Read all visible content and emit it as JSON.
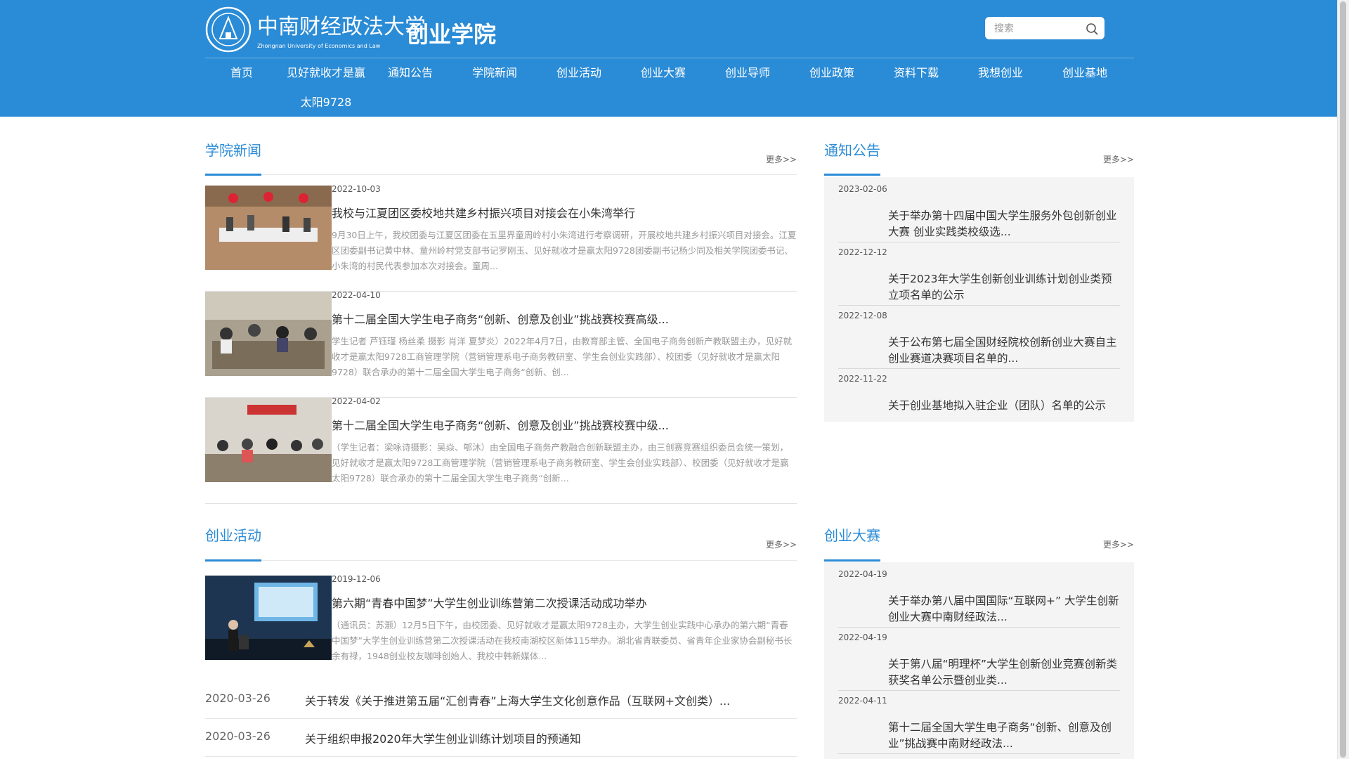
{
  "header": {
    "logo_cn": "中南财经政法大学",
    "logo_en": "Zhongnan University of Economics and Law",
    "site_name": "创业学院",
    "search_placeholder": "搜索"
  },
  "nav": [
    "首页",
    "见好就收才是赢",
    "通知公告",
    "学院新闻",
    "创业活动",
    "创业大赛",
    "创业导师",
    "创业政策",
    "资料下载",
    "我想创业",
    "创业基地",
    "太阳9728"
  ],
  "sections": {
    "news": {
      "title": "学院新闻",
      "more": "更多>>",
      "items": [
        {
          "date": "2022-10-03",
          "title": "我校与江夏团区委校地共建乡村振兴项目对接会在小朱湾举行",
          "summary": "9月30日上午，我校团委与江夏区团委在五里界童周岭村小朱湾进行考察调研，开展校地共建乡村振兴项目对接会。江夏区团委副书记黄中林、童州岭村党支部书记罗刚玉、见好就收才是赢太阳9728团委副书记杨少同及相关学院团委书记、小朱湾的村民代表参加本次对接会。童周..."
        },
        {
          "date": "2022-04-10",
          "title": "第十二届全国大学生电子商务“创新、创意及创业”挑战赛校赛高级...",
          "summary": "学生记者 芦钰瑾 杨丝柔 摄影 肖洋 夏梦炎）2022年4月7日，由教育部主管、全国电子商务创新产教联盟主办，见好就收才是赢太阳9728工商管理学院（营销管理系电子商务教研室、学生会创业实践部）、校团委（见好就收才是赢太阳9728）联合承办的第十二届全国大学生电子商务“创新、创..."
        },
        {
          "date": "2022-04-02",
          "title": "第十二届全国大学生电子商务“创新、创意及创业”挑战赛校赛中级...",
          "summary": "（学生记者：梁咏诗摄影：吴焱、郇沐）由全国电子商务产教融合创新联盟主办，由三创赛竞赛组织委员会统一策划，见好就收才是赢太阳9728工商管理学院（营销管理系电子商务教研室、学生会创业实践部）、校团委（见好就收才是赢太阳9728）联合承办的第十二届全国大学生电子商务“创新..."
        }
      ]
    },
    "notices": {
      "title": "通知公告",
      "more": "更多>>",
      "items": [
        {
          "date": "2023-02-06",
          "title": "关于举办第十四届中国大学生服务外包创新创业大赛 创业实践类校级选..."
        },
        {
          "date": "2022-12-12",
          "title": "关于2023年大学生创新创业训练计划创业类预立项名单的公示"
        },
        {
          "date": "2022-12-08",
          "title": "关于公布第七届全国财经院校创新创业大赛自主创业赛道决赛项目名单的..."
        },
        {
          "date": "2022-11-22",
          "title": "关于创业基地拟入驻企业（团队）名单的公示"
        }
      ]
    },
    "activities": {
      "title": "创业活动",
      "more": "更多>>",
      "feature": {
        "date": "2019-12-06",
        "title": "第六期“青春中国梦”大学生创业训练营第二次授课活动成功举办",
        "summary": "（通讯员：苏灏）12月5日下午，由校团委、见好就收才是赢太阳9728主办，大学生创业实践中心承办的第六期“青春中国梦”大学生创业训练营第二次授课活动在我校南湖校区新体115举办。湖北省青联委员、省青年企业家协会副秘书长余有禄，1948创业校友咖啡创始人、我校中韩新媒体..."
      },
      "list": [
        {
          "date": "2020-03-26",
          "title": "关于转发《关于推进第五届“汇创青春”上海大学生文化创意作品（互联网+文创类）..."
        },
        {
          "date": "2020-03-26",
          "title": "关于组织申报2020年大学生创业训练计划项目的预通知"
        }
      ]
    },
    "competitions": {
      "title": "创业大赛",
      "more": "更多>>",
      "items": [
        {
          "date": "2022-04-19",
          "title": "关于举办第八届中国国际“互联网+” 大学生创新创业大赛中南财经政法..."
        },
        {
          "date": "2022-04-19",
          "title": "关于第八届“明理杯”大学生创新创业竞赛创新类获奖名单公示暨创业类..."
        },
        {
          "date": "2022-04-11",
          "title": "第十二届全国大学生电子商务“创新、创意及创业”挑战赛中南财经政法..."
        }
      ]
    }
  },
  "colors": {
    "brand": "#2a8bd6",
    "panel": "#f4f4f4"
  }
}
